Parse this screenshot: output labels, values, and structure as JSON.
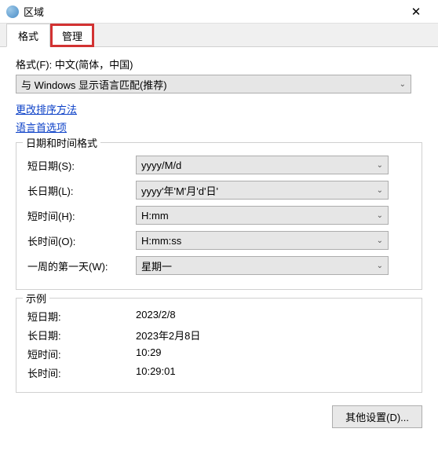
{
  "window": {
    "title": "区域"
  },
  "tabs": {
    "format": "格式",
    "admin": "管理"
  },
  "format_section": {
    "label": "格式(F): 中文(简体，中国)",
    "dropdown": "与 Windows 显示语言匹配(推荐)"
  },
  "links": {
    "change_sort": "更改排序方法",
    "language_pref": "语言首选项"
  },
  "datetime_group": {
    "title": "日期和时间格式",
    "rows": {
      "short_date_label": "短日期(S):",
      "short_date_value": "yyyy/M/d",
      "long_date_label": "长日期(L):",
      "long_date_value": "yyyy'年'M'月'd'日'",
      "short_time_label": "短时间(H):",
      "short_time_value": "H:mm",
      "long_time_label": "长时间(O):",
      "long_time_value": "H:mm:ss",
      "first_day_label": "一周的第一天(W):",
      "first_day_value": "星期一"
    }
  },
  "example_group": {
    "title": "示例",
    "rows": {
      "short_date_label": "短日期:",
      "short_date_value": "2023/2/8",
      "long_date_label": "长日期:",
      "long_date_value": "2023年2月8日",
      "short_time_label": "短时间:",
      "short_time_value": "10:29",
      "long_time_label": "长时间:",
      "long_time_value": "10:29:01"
    }
  },
  "footer": {
    "other_settings": "其他设置(D)..."
  }
}
